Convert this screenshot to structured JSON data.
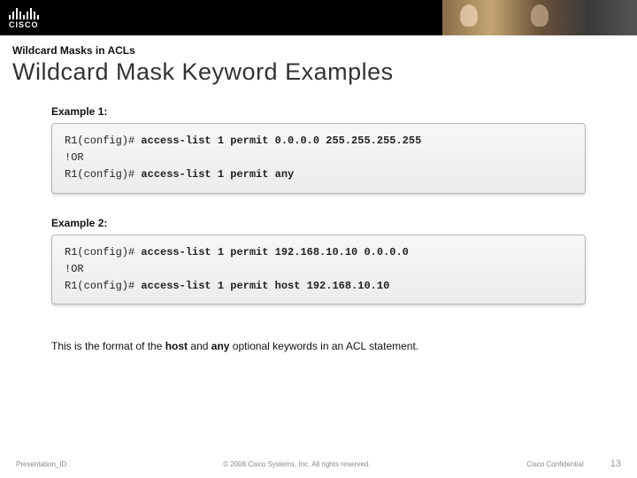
{
  "brand": {
    "name": "CISCO"
  },
  "header": {
    "subtitle": "Wildcard Masks in ACLs",
    "title": "Wildcard Mask Keyword Examples"
  },
  "examples": [
    {
      "label": "Example 1:",
      "lines": [
        {
          "prompt": "R1(config)#",
          "cmd": "access-list 1 permit 0.0.0.0 255.255.255.255"
        },
        {
          "note": "!OR"
        },
        {
          "prompt": "R1(config)#",
          "cmd": "access-list 1 permit any"
        }
      ]
    },
    {
      "label": "Example 2:",
      "lines": [
        {
          "prompt": "R1(config)#",
          "cmd": "access-list 1 permit 192.168.10.10 0.0.0.0"
        },
        {
          "note": "!OR"
        },
        {
          "prompt": "R1(config)#",
          "cmd": "access-list 1 permit host 192.168.10.10"
        }
      ]
    }
  ],
  "caption": {
    "pre": "This is the format of the ",
    "kw1": "host",
    "mid": " and ",
    "kw2": "any",
    "post": " optional keywords in an ACL statement."
  },
  "footer": {
    "presentation_id": "Presentation_ID",
    "copyright": "© 2008 Cisco Systems, Inc. All rights reserved.",
    "confidential": "Cisco Confidential",
    "page": "13"
  }
}
